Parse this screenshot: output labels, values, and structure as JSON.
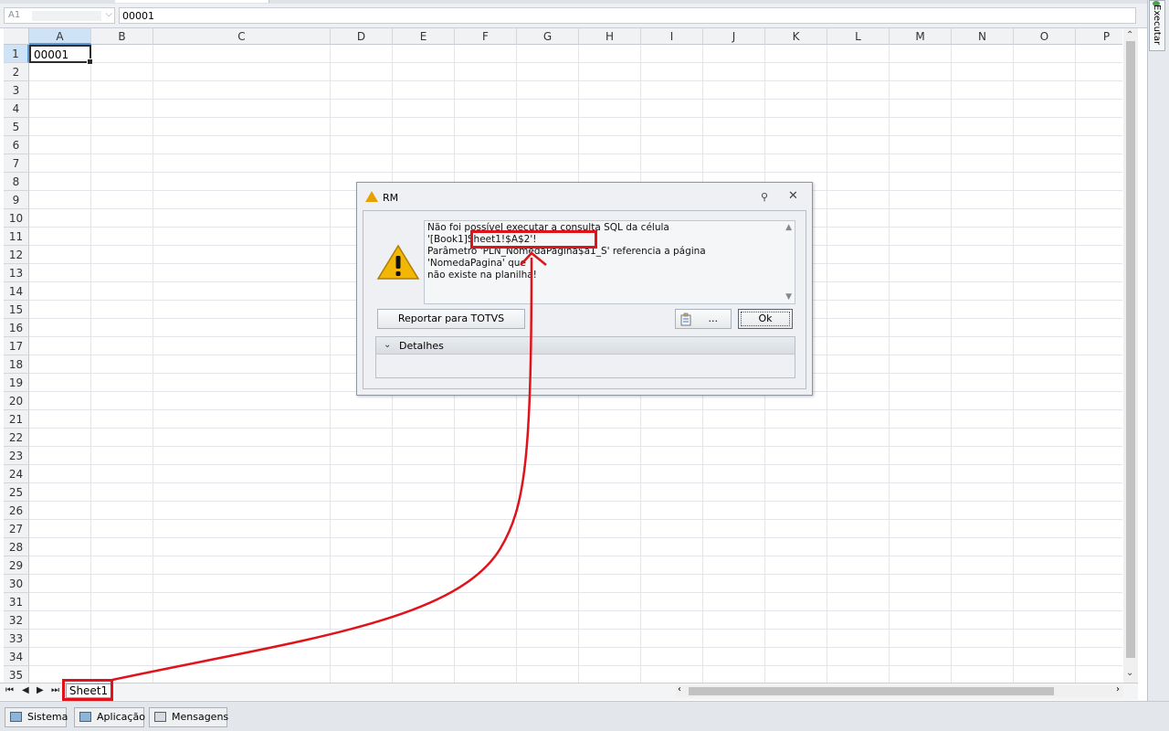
{
  "toolbar": {
    "execute_label": "Executar"
  },
  "formula_bar": {
    "name_box": "A1",
    "formula_value": "00001"
  },
  "columns": [
    "A",
    "B",
    "C",
    "D",
    "E",
    "F",
    "G",
    "H",
    "I",
    "J",
    "K",
    "L",
    "M",
    "N",
    "O",
    "P"
  ],
  "rows": [
    "1",
    "2",
    "3",
    "4",
    "5",
    "6",
    "7",
    "8",
    "9",
    "10",
    "11",
    "12",
    "13",
    "14",
    "15",
    "16",
    "17",
    "18",
    "19",
    "20",
    "21",
    "22",
    "23",
    "24",
    "25",
    "26",
    "27",
    "28",
    "29",
    "30",
    "31",
    "32",
    "33",
    "34",
    "35"
  ],
  "active_cell": {
    "ref": "A1",
    "value": "00001"
  },
  "sheet_tabs": {
    "nav": [
      "⏮",
      "◀",
      "▶",
      "⏭"
    ],
    "tabs": [
      {
        "label": "Sheet1"
      }
    ]
  },
  "status_tabs": [
    {
      "label": "Sistema"
    },
    {
      "label": "Aplicação"
    },
    {
      "label": "Mensagens"
    }
  ],
  "dialog": {
    "title": "RM",
    "message": "Não foi possível executar a consulta SQL da célula '[Book1]Sheet1!$A$2'!\nParâmetro 'PLN_NomedaPagina$a1_S' referencia a página 'NomedaPagina' que\nnão existe na planilha!",
    "report_button": "Reportar para TOTVS",
    "more_button": "...",
    "ok_button": "Ok",
    "details_label": "Detalhes"
  },
  "colors": {
    "highlight": "#e0131a",
    "selection": "#cfe3f7",
    "warning": "#e6a100"
  }
}
